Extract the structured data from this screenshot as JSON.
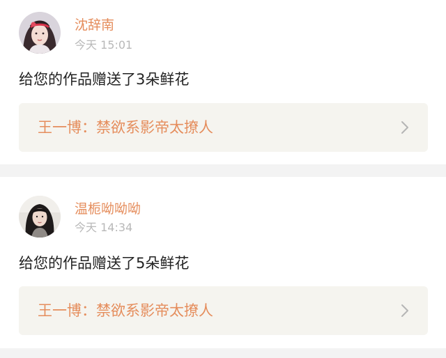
{
  "notifications": [
    {
      "username": "沈辞南",
      "time": "今天 15:01",
      "message": "给您的作品赠送了3朵鲜花",
      "work_title": "王一博：禁欲系影帝太撩人",
      "avatar_icon": "avatar-girl-headband-icon",
      "chevron_icon": "chevron-right-icon"
    },
    {
      "username": "温栀呦呦呦",
      "time": "今天 14:34",
      "message": "给您的作品赠送了5朵鲜花",
      "work_title": "王一博：禁欲系影帝太撩人",
      "avatar_icon": "avatar-girl-longhair-icon",
      "chevron_icon": "chevron-right-icon"
    }
  ],
  "colors": {
    "accent": "#e58d5c",
    "timestamp": "#b8b8b8",
    "link_bg": "#f5f4ef",
    "separator": "#f3f3f3"
  }
}
